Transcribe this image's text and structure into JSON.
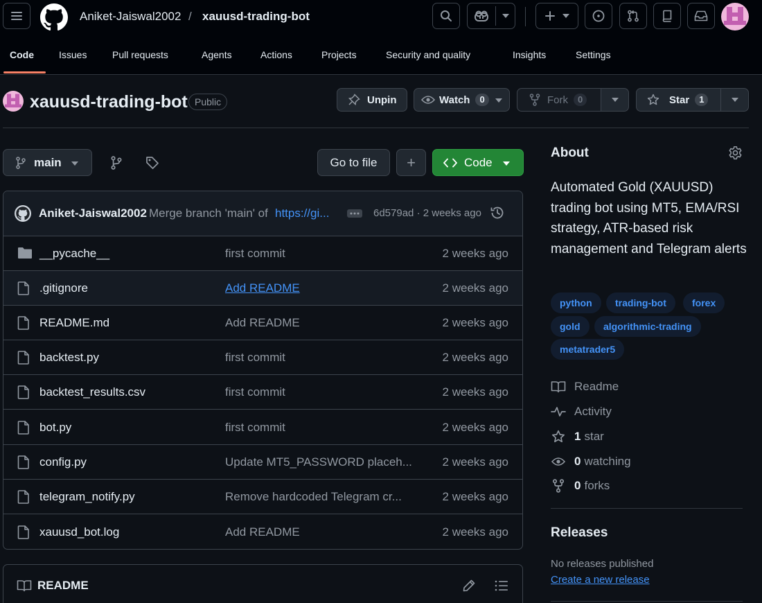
{
  "header": {
    "owner": "Aniket-Jaiswal2002",
    "separator": "/",
    "repo": "xauusd-trading-bot"
  },
  "nav": {
    "tabs": [
      "Code",
      "Issues",
      "Pull requests",
      "Agents",
      "Actions",
      "Projects",
      "Security and quality",
      "Insights",
      "Settings"
    ],
    "active": "Code"
  },
  "repo": {
    "name": "xauusd-trading-bot",
    "visibility": "Public",
    "unpin_label": "Unpin",
    "watch_label": "Watch",
    "watch_count": "0",
    "fork_label": "Fork",
    "fork_count": "0",
    "star_label": "Star",
    "star_count": "1"
  },
  "toolbar": {
    "branch": "main",
    "go_to_file": "Go to file",
    "add": "+",
    "code": "Code"
  },
  "commit": {
    "author": "Aniket-Jaiswal2002",
    "message": "Merge branch 'main' of",
    "link": "https://gi...",
    "hash_time": "6d579ad · 2 weeks ago"
  },
  "files": [
    {
      "name": "__pycache__",
      "type": "folder",
      "message": "first commit",
      "time": "2 weeks ago"
    },
    {
      "name": ".gitignore",
      "type": "file",
      "message": "Add README",
      "time": "2 weeks ago"
    },
    {
      "name": "README.md",
      "type": "file",
      "message": "Add README",
      "time": "2 weeks ago"
    },
    {
      "name": "backtest.py",
      "type": "file",
      "message": "first commit",
      "time": "2 weeks ago"
    },
    {
      "name": "backtest_results.csv",
      "type": "file",
      "message": "first commit",
      "time": "2 weeks ago"
    },
    {
      "name": "bot.py",
      "type": "file",
      "message": "first commit",
      "time": "2 weeks ago"
    },
    {
      "name": "config.py",
      "type": "file",
      "message": "Update MT5_PASSWORD placeh...",
      "time": "2 weeks ago"
    },
    {
      "name": "telegram_notify.py",
      "type": "file",
      "message": "Remove hardcoded Telegram cr...",
      "time": "2 weeks ago"
    },
    {
      "name": "xauusd_bot.log",
      "type": "file",
      "message": "Add README",
      "time": "2 weeks ago"
    }
  ],
  "readme": {
    "title": "README"
  },
  "about": {
    "title": "About",
    "description": "Automated Gold (XAUUSD) trading bot using MT5, EMA/RSI strategy, ATR-based risk management and Telegram alerts",
    "topics": [
      "python",
      "trading-bot",
      "forex",
      "gold",
      "algorithmic-trading",
      "metatrader5"
    ],
    "readme": "Readme",
    "activity": "Activity",
    "stars_count": "1",
    "stars_label": "star",
    "watching_count": "0",
    "watching_label": "watching",
    "forks_count": "0",
    "forks_label": "forks"
  },
  "releases": {
    "title": "Releases",
    "none": "No releases published",
    "create": "Create a new release"
  }
}
